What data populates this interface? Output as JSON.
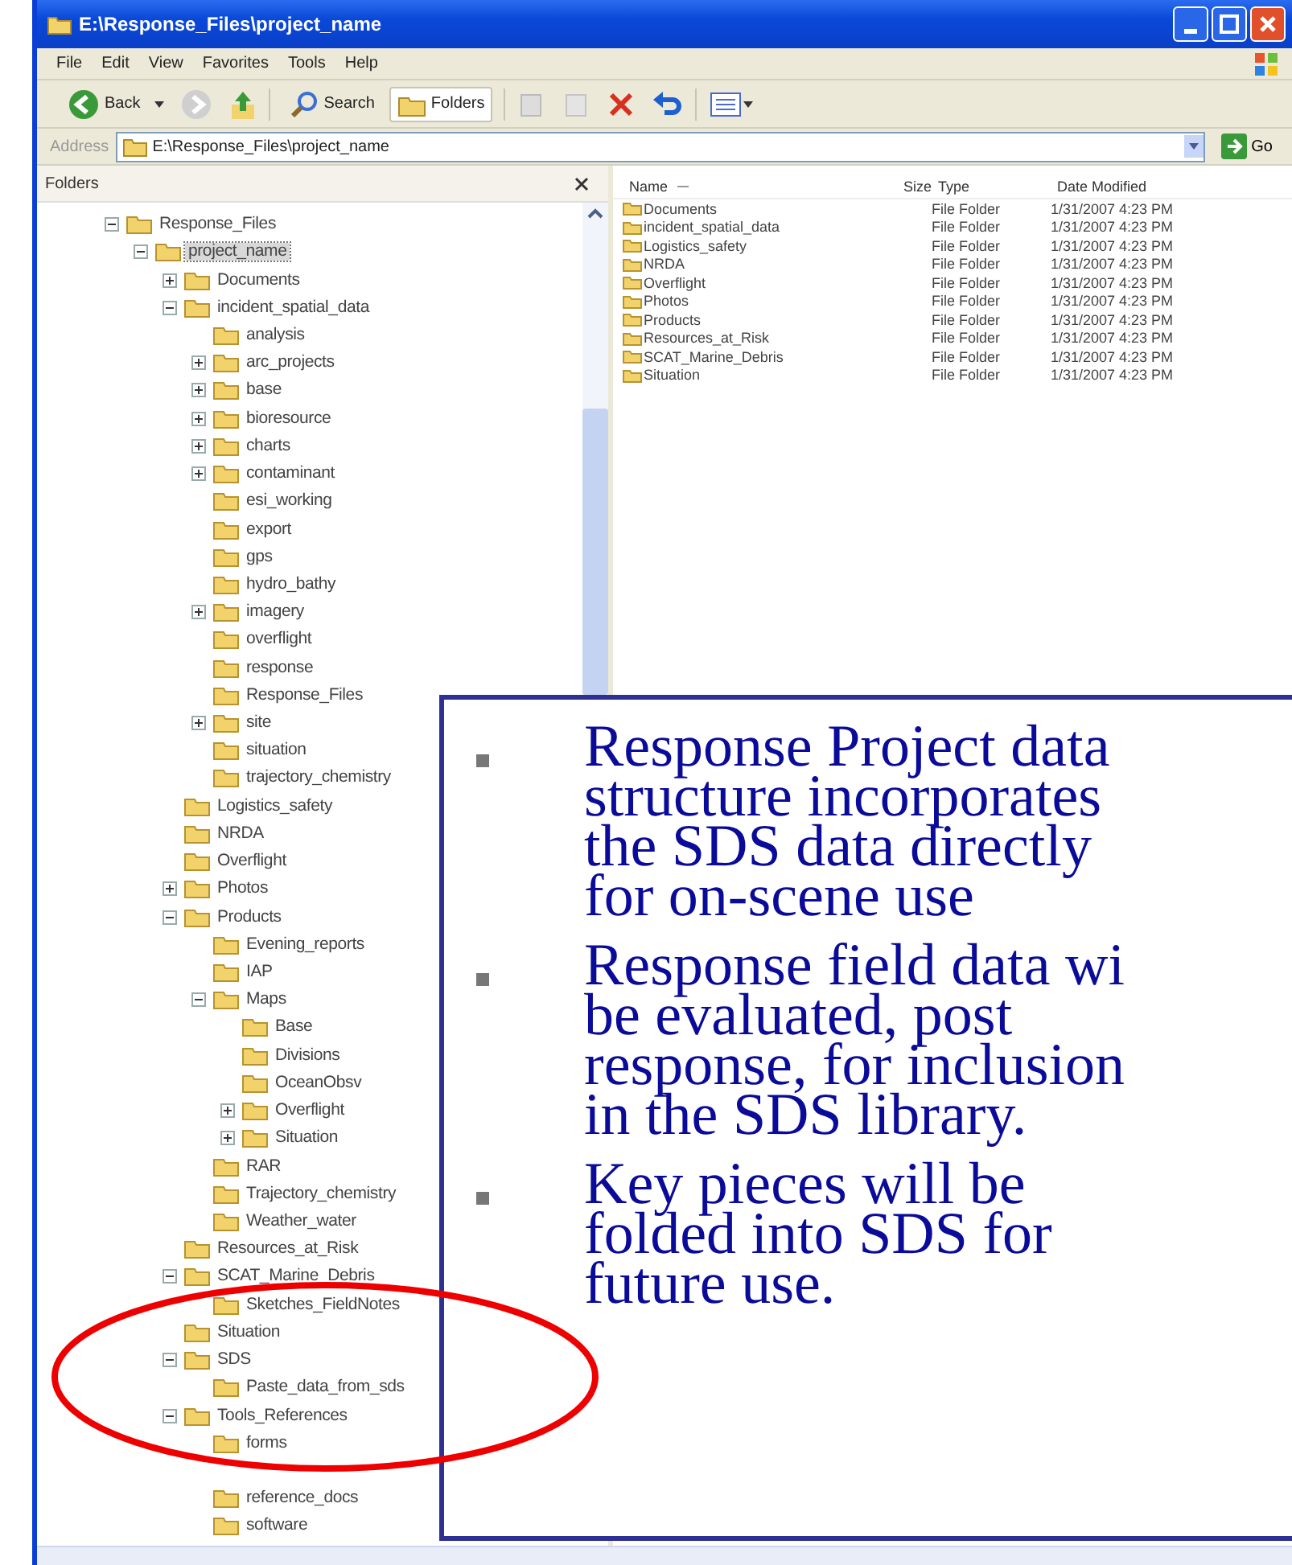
{
  "window": {
    "title": "E:\\Response_Files\\project_name"
  },
  "menu": [
    "File",
    "Edit",
    "View",
    "Favorites",
    "Tools",
    "Help"
  ],
  "toolbar": {
    "back": "Back",
    "search": "Search",
    "folders": "Folders"
  },
  "address": {
    "label": "Address",
    "value": "E:\\Response_Files\\project_name",
    "go": "Go"
  },
  "folders_pane": {
    "title": "Folders",
    "tree": [
      {
        "label": "Response_Files",
        "expanded": true,
        "selected": false,
        "children": [
          {
            "label": "project_name",
            "expanded": true,
            "selected": true,
            "children": [
              {
                "label": "Documents",
                "expanded": false,
                "selected": false
              },
              {
                "label": "incident_spatial_data",
                "expanded": true,
                "selected": false,
                "children": [
                  {
                    "label": "analysis",
                    "selected": false
                  },
                  {
                    "label": "arc_projects",
                    "expanded": false,
                    "selected": false
                  },
                  {
                    "label": "base",
                    "expanded": false,
                    "selected": false
                  },
                  {
                    "label": "bioresource",
                    "expanded": false,
                    "selected": false
                  },
                  {
                    "label": "charts",
                    "expanded": false,
                    "selected": false
                  },
                  {
                    "label": "contaminant",
                    "expanded": false,
                    "selected": false
                  },
                  {
                    "label": "esi_working",
                    "selected": false
                  },
                  {
                    "label": "export",
                    "selected": false
                  },
                  {
                    "label": "gps",
                    "selected": false
                  },
                  {
                    "label": "hydro_bathy",
                    "selected": false
                  },
                  {
                    "label": "imagery",
                    "expanded": false,
                    "selected": false
                  },
                  {
                    "label": "overflight",
                    "selected": false
                  },
                  {
                    "label": "response",
                    "selected": false
                  },
                  {
                    "label": "Response_Files",
                    "selected": false
                  },
                  {
                    "label": "site",
                    "expanded": false,
                    "selected": false
                  },
                  {
                    "label": "situation",
                    "selected": false
                  },
                  {
                    "label": "trajectory_chemistry",
                    "selected": false
                  }
                ]
              },
              {
                "label": "Logistics_safety",
                "selected": false
              },
              {
                "label": "NRDA",
                "selected": false
              },
              {
                "label": "Overflight",
                "selected": false
              },
              {
                "label": "Photos",
                "expanded": false,
                "selected": false
              },
              {
                "label": "Products",
                "expanded": true,
                "selected": false,
                "children": [
                  {
                    "label": "Evening_reports",
                    "selected": false
                  },
                  {
                    "label": "IAP",
                    "selected": false
                  },
                  {
                    "label": "Maps",
                    "expanded": true,
                    "selected": false,
                    "children": [
                      {
                        "label": "Base",
                        "selected": false
                      },
                      {
                        "label": "Divisions",
                        "selected": false
                      },
                      {
                        "label": "OceanObsv",
                        "selected": false
                      },
                      {
                        "label": "Overflight",
                        "expanded": false,
                        "selected": false
                      },
                      {
                        "label": "Situation",
                        "expanded": false,
                        "selected": false
                      }
                    ]
                  },
                  {
                    "label": "RAR",
                    "selected": false
                  },
                  {
                    "label": "Trajectory_chemistry",
                    "selected": false
                  },
                  {
                    "label": "Weather_water",
                    "selected": false
                  }
                ]
              },
              {
                "label": "Resources_at_Risk",
                "selected": false
              },
              {
                "label": "SCAT_Marine_Debris",
                "expanded": true,
                "selected": false,
                "children": [
                  {
                    "label": "Sketches_FieldNotes",
                    "selected": false
                  }
                ]
              },
              {
                "label": "Situation",
                "selected": false
              },
              {
                "label": "SDS",
                "expanded": true,
                "selected": false,
                "children": [
                  {
                    "label": "Paste_data_from_sds",
                    "selected": false
                  }
                ]
              },
              {
                "label": "Tools_References",
                "expanded": true,
                "selected": false,
                "children": [
                  {
                    "label": "forms",
                    "selected": false
                  },
                  {
                    "selected": false
                  },
                  {
                    "label": "reference_docs",
                    "selected": false
                  },
                  {
                    "label": "software",
                    "selected": false
                  }
                ]
              }
            ]
          }
        ]
      }
    ]
  },
  "file_list": {
    "columns": [
      "Name",
      "Size",
      "Type",
      "Date Modified"
    ],
    "rows": [
      {
        "name": "Documents",
        "type": "File Folder",
        "date": "1/31/2007 4:23 PM"
      },
      {
        "name": "incident_spatial_data",
        "type": "File Folder",
        "date": "1/31/2007 4:23 PM"
      },
      {
        "name": "Logistics_safety",
        "type": "File Folder",
        "date": "1/31/2007 4:23 PM"
      },
      {
        "name": "NRDA",
        "type": "File Folder",
        "date": "1/31/2007 4:23 PM"
      },
      {
        "name": "Overflight",
        "type": "File Folder",
        "date": "1/31/2007 4:23 PM"
      },
      {
        "name": "Photos",
        "type": "File Folder",
        "date": "1/31/2007 4:23 PM"
      },
      {
        "name": "Products",
        "type": "File Folder",
        "date": "1/31/2007 4:23 PM"
      },
      {
        "name": "Resources_at_Risk",
        "type": "File Folder",
        "date": "1/31/2007 4:23 PM"
      },
      {
        "name": "SCAT_Marine_Debris",
        "type": "File Folder",
        "date": "1/31/2007 4:23 PM"
      },
      {
        "name": "Situation",
        "type": "File Folder",
        "date": "1/31/2007 4:23 PM"
      }
    ]
  },
  "callout": {
    "bullets": [
      {
        "lines": [
          "Response Project data",
          "structure incorporates",
          "the SDS data directly",
          "for on-scene use"
        ]
      },
      {
        "lines": [
          "Response field data wi",
          "be evaluated, post",
          "response, for inclusion",
          "in the SDS library."
        ]
      },
      {
        "lines": [
          "Key pieces will be",
          "folded into SDS for",
          "future use."
        ]
      }
    ]
  }
}
